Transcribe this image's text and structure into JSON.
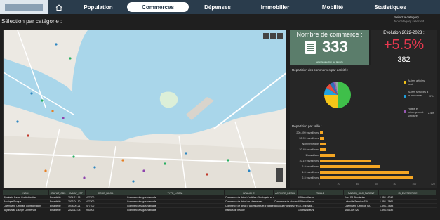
{
  "nav": {
    "tabs": [
      {
        "label": "Population"
      },
      {
        "label": "Commerces"
      },
      {
        "label": "Dépenses"
      },
      {
        "label": "Immobilier"
      },
      {
        "label": "Mobilité"
      },
      {
        "label": "Statistiques"
      }
    ],
    "active_tab": "Commerces"
  },
  "page": {
    "title": "Sélection par catégorie :"
  },
  "category_selector": {
    "title": "Select a category",
    "placeholder": "No category selected"
  },
  "kpi": {
    "label": "Nombre de commerce :",
    "value": "333",
    "note": "selon la sélection sur la carte"
  },
  "evolution": {
    "label": "Evolution 2022-2023 :",
    "percent": "+5.5%",
    "count": "382",
    "color": "#e8384f"
  },
  "activity_panel": {
    "title": "Répartition des commerces par activité :",
    "legend": [
      {
        "label": "Autres articles neuf",
        "value": "",
        "color": "#f5c518"
      },
      {
        "label": "Autres services à la personne",
        "value": "9%",
        "color": "#1fa2e0"
      },
      {
        "label": "Hôtels et hébergement similaire",
        "value": "2.4%",
        "color": "#9b59b6"
      }
    ],
    "chart_data": {
      "type": "pie",
      "slices": [
        {
          "color": "#3fbf4a",
          "value": 50
        },
        {
          "color": "#f5c518",
          "value": 25
        },
        {
          "color": "#1fa2e0",
          "value": 9
        },
        {
          "color": "#e74c3c",
          "value": 6
        },
        {
          "color": "#2c6fbb",
          "value": 5
        },
        {
          "color": "#9b59b6",
          "value": 2.4
        },
        {
          "color": "#95a5a6",
          "value": 2.6
        }
      ]
    }
  },
  "size_panel": {
    "title": "Répartition par taille :",
    "chart_data": {
      "type": "bar",
      "categories": [
        "200-499 travailleurs",
        "50-99 travailleurs",
        "Non renseigné",
        "20-49 travailleurs",
        "1 travailleur",
        "10-19 travailleurs",
        "6-9 travailleurs",
        "1-5 travailleurs",
        "2-5 travailleurs"
      ],
      "values": [
        3,
        4,
        6,
        7,
        16,
        55,
        64,
        95,
        100
      ],
      "xlim": [
        0,
        120
      ],
      "ticks": [
        "0",
        "20",
        "40",
        "60",
        "80",
        "100",
        "120"
      ],
      "color": "#f5a623"
    }
  },
  "table": {
    "columns": [
      "NOM",
      "STATUT_OBS",
      "IMMAT_EFF",
      "CODE_NOGA",
      "TYPE_LOCAL",
      "BRANCHE",
      "ACTIVITE_DETAIL",
      "TAILLE",
      "RAISON_SOC_PARENT",
      "ID_ENTREPRISE"
    ],
    "rows": [
      [
        "Bijouterie Bader Confédération",
        "En activité",
        "2004-12-15",
        "477700",
        "Commerce/magasin/arcade",
        "Commerce de détail d'articles d'horlogerie et de bijouterie en magasin spécialisé",
        "",
        "6-9 travailleurs",
        "Kurz SA Bijouteries",
        "1-894-16242"
      ],
      [
        "Boutique Bruque",
        "En activité",
        "2003-04-10",
        "477200",
        "Commerce/magasin/arcade",
        "Commerce de détail de chaussures",
        "Commerce de chaussures, vêtements",
        "6-9 travailleurs",
        "Lakeside Fashion S.A.",
        "1-894-17861"
      ],
      [
        "Chemiserie Centrale Confédération",
        "En activité",
        "1978-09-21",
        "477100",
        "Commerce/magasin/arcade",
        "Commerce de détail d'accessoires et d'habillement pour professionnel",
        "Boutique Hommes/Femmes",
        "10-19 travaill...",
        "Chemiserie Centrale SA",
        "1-894-17488"
      ],
      [
        "Akyols Nail Lounge Centre Vilb",
        "En activité",
        "2023-12-08",
        "960202",
        "Commerce/magasin/arcade",
        "Instituts de beauté",
        "",
        "1-5 travailleurs",
        "MALOAN SA",
        "1-894-07182"
      ]
    ]
  }
}
